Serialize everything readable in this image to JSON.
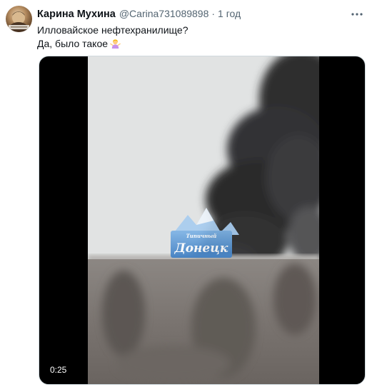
{
  "tweet": {
    "author": {
      "display_name": "Карина Мухина",
      "handle": "@Carina731089898",
      "separator": "·",
      "time": "1 год"
    },
    "text_lines": [
      "Илловайское нефтехранилище?",
      "Да, было такое"
    ],
    "emoji": "woman-shrugging-emoji",
    "media": {
      "type": "video",
      "duration": "0:25",
      "watermark": {
        "small_text": "Типичный",
        "main_text": "Донецк"
      }
    },
    "icons": {
      "more": "more-dots-icon",
      "avatar": "avatar-image"
    }
  }
}
